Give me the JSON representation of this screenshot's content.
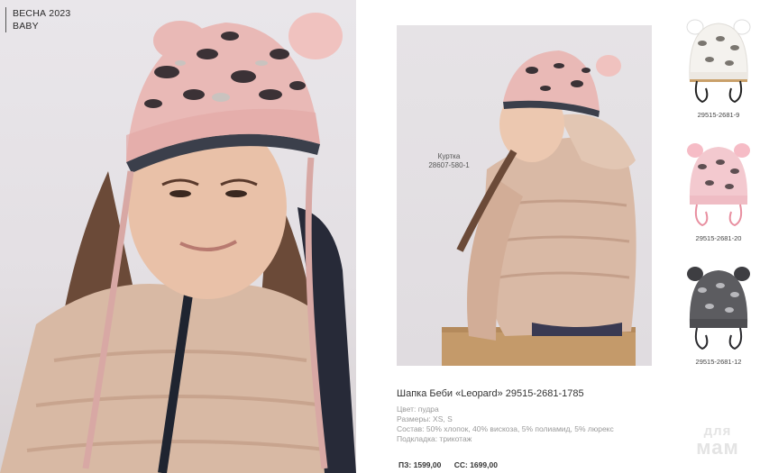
{
  "header": {
    "season_line1": "ВЕСНА 2023",
    "season_line2": "BABY"
  },
  "jacket_note": {
    "label": "Куртка",
    "code": "28607-580-1"
  },
  "product": {
    "title": "Шапка Беби «Leopard» 29515-2681-1785",
    "color": "Цвет: пудра",
    "sizes": "Размеры: XS, S",
    "composition": "Состав: 50% хлопок, 40% вискоза, 5% полиамид, 5% люрекс",
    "lining": "Подкладка: трикотаж"
  },
  "prices": {
    "pz": "ПЗ: 1599,00",
    "ss": "СС: 1699,00"
  },
  "variants": [
    {
      "code": "29515-2681-9",
      "color": "#f4f2ee",
      "spots": "#7a7670",
      "ear": "#ffffff",
      "ties": "#222222"
    },
    {
      "code": "29515-2681-20",
      "color": "#f3c9cf",
      "spots": "#5e4f52",
      "ear": "#f6bcc6",
      "ties": "#e88fa0"
    },
    {
      "code": "29515-2681-12",
      "color": "#5c5c60",
      "spots": "#b8b8bc",
      "ear": "#3e3e42",
      "ties": "#2a2a2e"
    }
  ],
  "logo": {
    "line1": "для",
    "line2": "мам"
  },
  "colors": {
    "hat_pink": "#e9b9b6",
    "jacket_gold": "#d9b9a5",
    "leopard_dark": "#3b3236"
  }
}
